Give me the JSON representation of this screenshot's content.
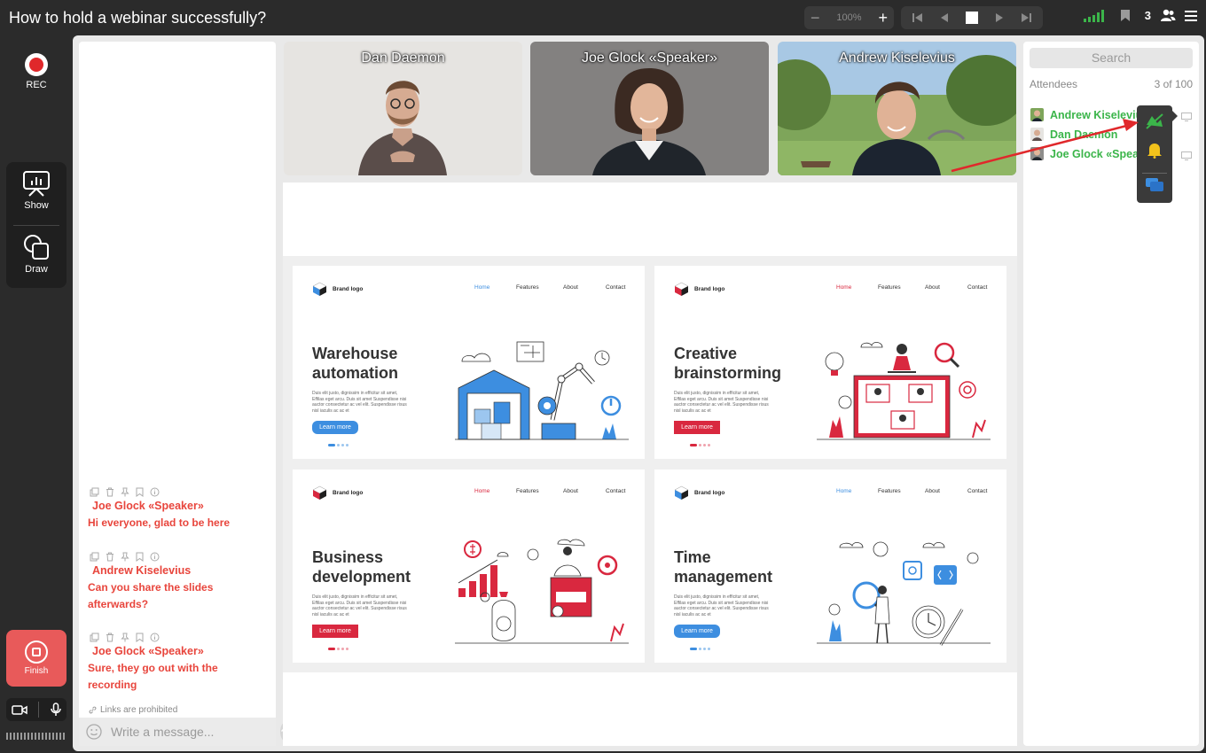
{
  "title": "How to hold a webinar successfully?",
  "toolbar": {
    "zoom_value": "100%",
    "participants_count": "3"
  },
  "rail": {
    "rec_label": "REC",
    "show_label": "Show",
    "draw_label": "Draw",
    "finish_label": "Finish"
  },
  "chat": {
    "messages": [
      {
        "author": "Joe Glock «Speaker»",
        "text": "Hi everyone, glad to be here"
      },
      {
        "author": "Andrew Kiselevius",
        "text": "Can you share the slides afterwards?"
      },
      {
        "author": "Joe Glock «Speaker»",
        "text": "Sure, they go out with the recording"
      }
    ],
    "notice": "Links are prohibited",
    "placeholder": "Write a message..."
  },
  "videos": [
    {
      "name": "Dan Daemon"
    },
    {
      "name": "Joe Glock «Speaker»"
    },
    {
      "name": "Andrew Kiselevius"
    }
  ],
  "slides": [
    {
      "brand": "Brand logo",
      "nav": [
        "Home",
        "Features",
        "About",
        "Contact"
      ],
      "title": "Warehouse automation",
      "lorem": "Duis elit justo, dignissim in efficitur sit amet, Effilas eget arcu. Duis sit amet Suspendisse nisi auctor consectetur ac vel elit. Suspendisse risus nisl iaculis ac ac et",
      "button": "Learn more",
      "accent": "#3d8ee0"
    },
    {
      "brand": "Brand logo",
      "nav": [
        "Home",
        "Features",
        "About",
        "Contact"
      ],
      "title": "Creative brainstorming",
      "lorem": "Duis elit justo, dignissim in efficitur sit amet, Effilas eget arcu. Duis sit amet Suspendisse nisi auctor consectetur ac vel elit. Suspendisse risus nisl iaculis ac ac et",
      "button": "Learn more",
      "accent": "#d9283f"
    },
    {
      "brand": "Brand logo",
      "nav": [
        "Home",
        "Features",
        "About",
        "Contact"
      ],
      "title": "Business development",
      "lorem": "Duis elit justo, dignissim in efficitur sit amet, Effilas eget arcu. Duis sit amet Suspendisse nisi auctor consectetur ac vel elit. Suspendisse risus nisl iaculis ac ac et",
      "button": "Learn more",
      "accent": "#d9283f"
    },
    {
      "brand": "Brand logo",
      "nav": [
        "Home",
        "Features",
        "About",
        "Contact"
      ],
      "title": "Time management",
      "lorem": "Duis elit justo, dignissim in efficitur sit amet, Effilas eget arcu. Duis sit amet Suspendisse nisi auctor consectetur ac vel elit. Suspendisse risus nisl iaculis ac ac et",
      "button": "Learn more",
      "accent": "#3d8ee0"
    }
  ],
  "attendees": {
    "search_placeholder": "Search",
    "label": "Attendees",
    "count": "3 of 100",
    "list": [
      {
        "name": "Andrew Kiselevius"
      },
      {
        "name": "Dan Daemon"
      },
      {
        "name": "Joe Glock «Speaker»"
      }
    ]
  },
  "colors": {
    "accent_red": "#e8453c",
    "online_green": "#3bb54a",
    "finish_red": "#e85a5a"
  },
  "icons": [
    "signal-icon",
    "bookmark-icon",
    "users-icon",
    "menu-icon",
    "present-icon",
    "draw-icon",
    "camera-icon",
    "mic-icon",
    "copy-icon",
    "trash-icon",
    "pin-icon",
    "bookmark-icon",
    "info-icon",
    "link-icon",
    "emoji-icon",
    "send-icon",
    "screen-icon",
    "mute-video-icon",
    "bell-icon",
    "chat-icon"
  ]
}
